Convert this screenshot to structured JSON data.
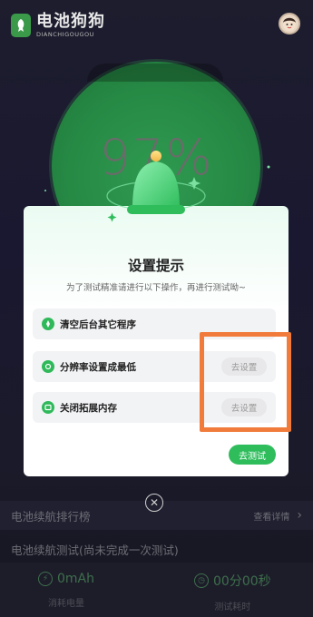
{
  "app": {
    "title": "电池狗狗",
    "subtitle": "DIANCHIGOUGOU"
  },
  "battery": {
    "percent_text": "97%",
    "level": 97
  },
  "modal": {
    "title": "设置提示",
    "subtitle": "为了测试精准请进行以下操作，再进行测试呦~",
    "options": [
      {
        "label": "清空后台其它程序",
        "icon": "rocket-icon",
        "button": ""
      },
      {
        "label": "分辨率设置成最低",
        "icon": "resolution-icon",
        "button": "去设置"
      },
      {
        "label": "关闭拓展内存",
        "icon": "memory-icon",
        "button": "去设置"
      }
    ],
    "go_button": "去测试"
  },
  "ranking": {
    "title": "电池续航排行榜",
    "detail": "查看详情"
  },
  "test": {
    "title": "电池续航测试(尚未完成一次测试)"
  },
  "stats": {
    "consumed_value": "0mAh",
    "consumed_label": "消耗电量",
    "time_value": "00分00秒",
    "time_label": "测试耗时"
  },
  "colors": {
    "accent_green": "#2fbd5c",
    "highlight_orange": "#f07b3a"
  }
}
